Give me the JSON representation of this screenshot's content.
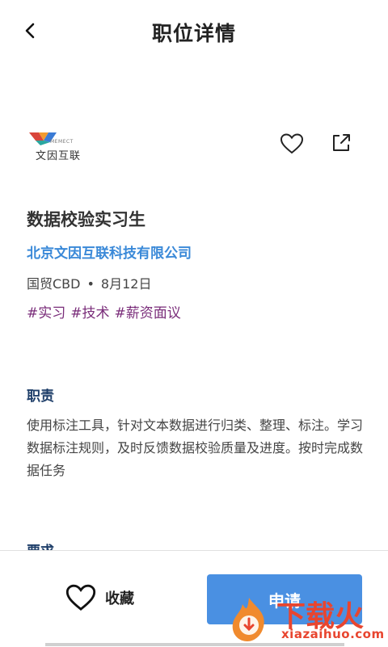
{
  "header": {
    "title": "职位详情"
  },
  "company_logo": {
    "name": "文因互联",
    "name_en": "MEMECT"
  },
  "job": {
    "title": "数据校验实习生",
    "company": "北京文因互联科技有限公司",
    "location": "国贸CBD",
    "separator": "•",
    "date": "8月12日",
    "tags": [
      "#实习",
      "#技术",
      "#薪资面议"
    ]
  },
  "sections": {
    "duty_title": "职责",
    "duty_text": "使用标注工具，针对文本数据进行归类、整理、标注。学习数据标注规则，及时反馈数据校验质量及进度。按时完成数据任务",
    "next_title": "要求"
  },
  "bottom": {
    "favorite_label": "收藏",
    "apply_label": "申请"
  },
  "watermark": {
    "cn": "下载火",
    "en": "xiazaihuo.com"
  },
  "colors": {
    "accent": "#4a90e2",
    "company_link": "#3a89d8",
    "tag": "#7a2d7a",
    "watermark": "#e8452f"
  }
}
